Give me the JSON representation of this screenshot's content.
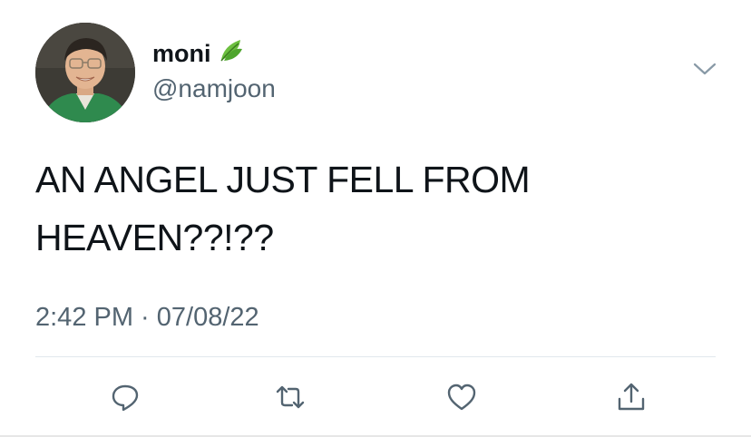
{
  "user": {
    "display_name": "moni",
    "name_emoji": "🍃",
    "handle": "@namjoon"
  },
  "tweet": {
    "text_line1": "AN ANGEL JUST FELL FROM",
    "text_line2": "HEAVEN??!??",
    "timestamp": "2:42 PM · 07/08/22"
  },
  "icons": {
    "more": "chevron-down-icon",
    "reply": "reply-icon",
    "retweet": "retweet-icon",
    "like": "heart-icon",
    "share": "share-icon"
  },
  "colors": {
    "text": "#0f1419",
    "secondary": "#536471",
    "divider": "#e1e8ed"
  }
}
